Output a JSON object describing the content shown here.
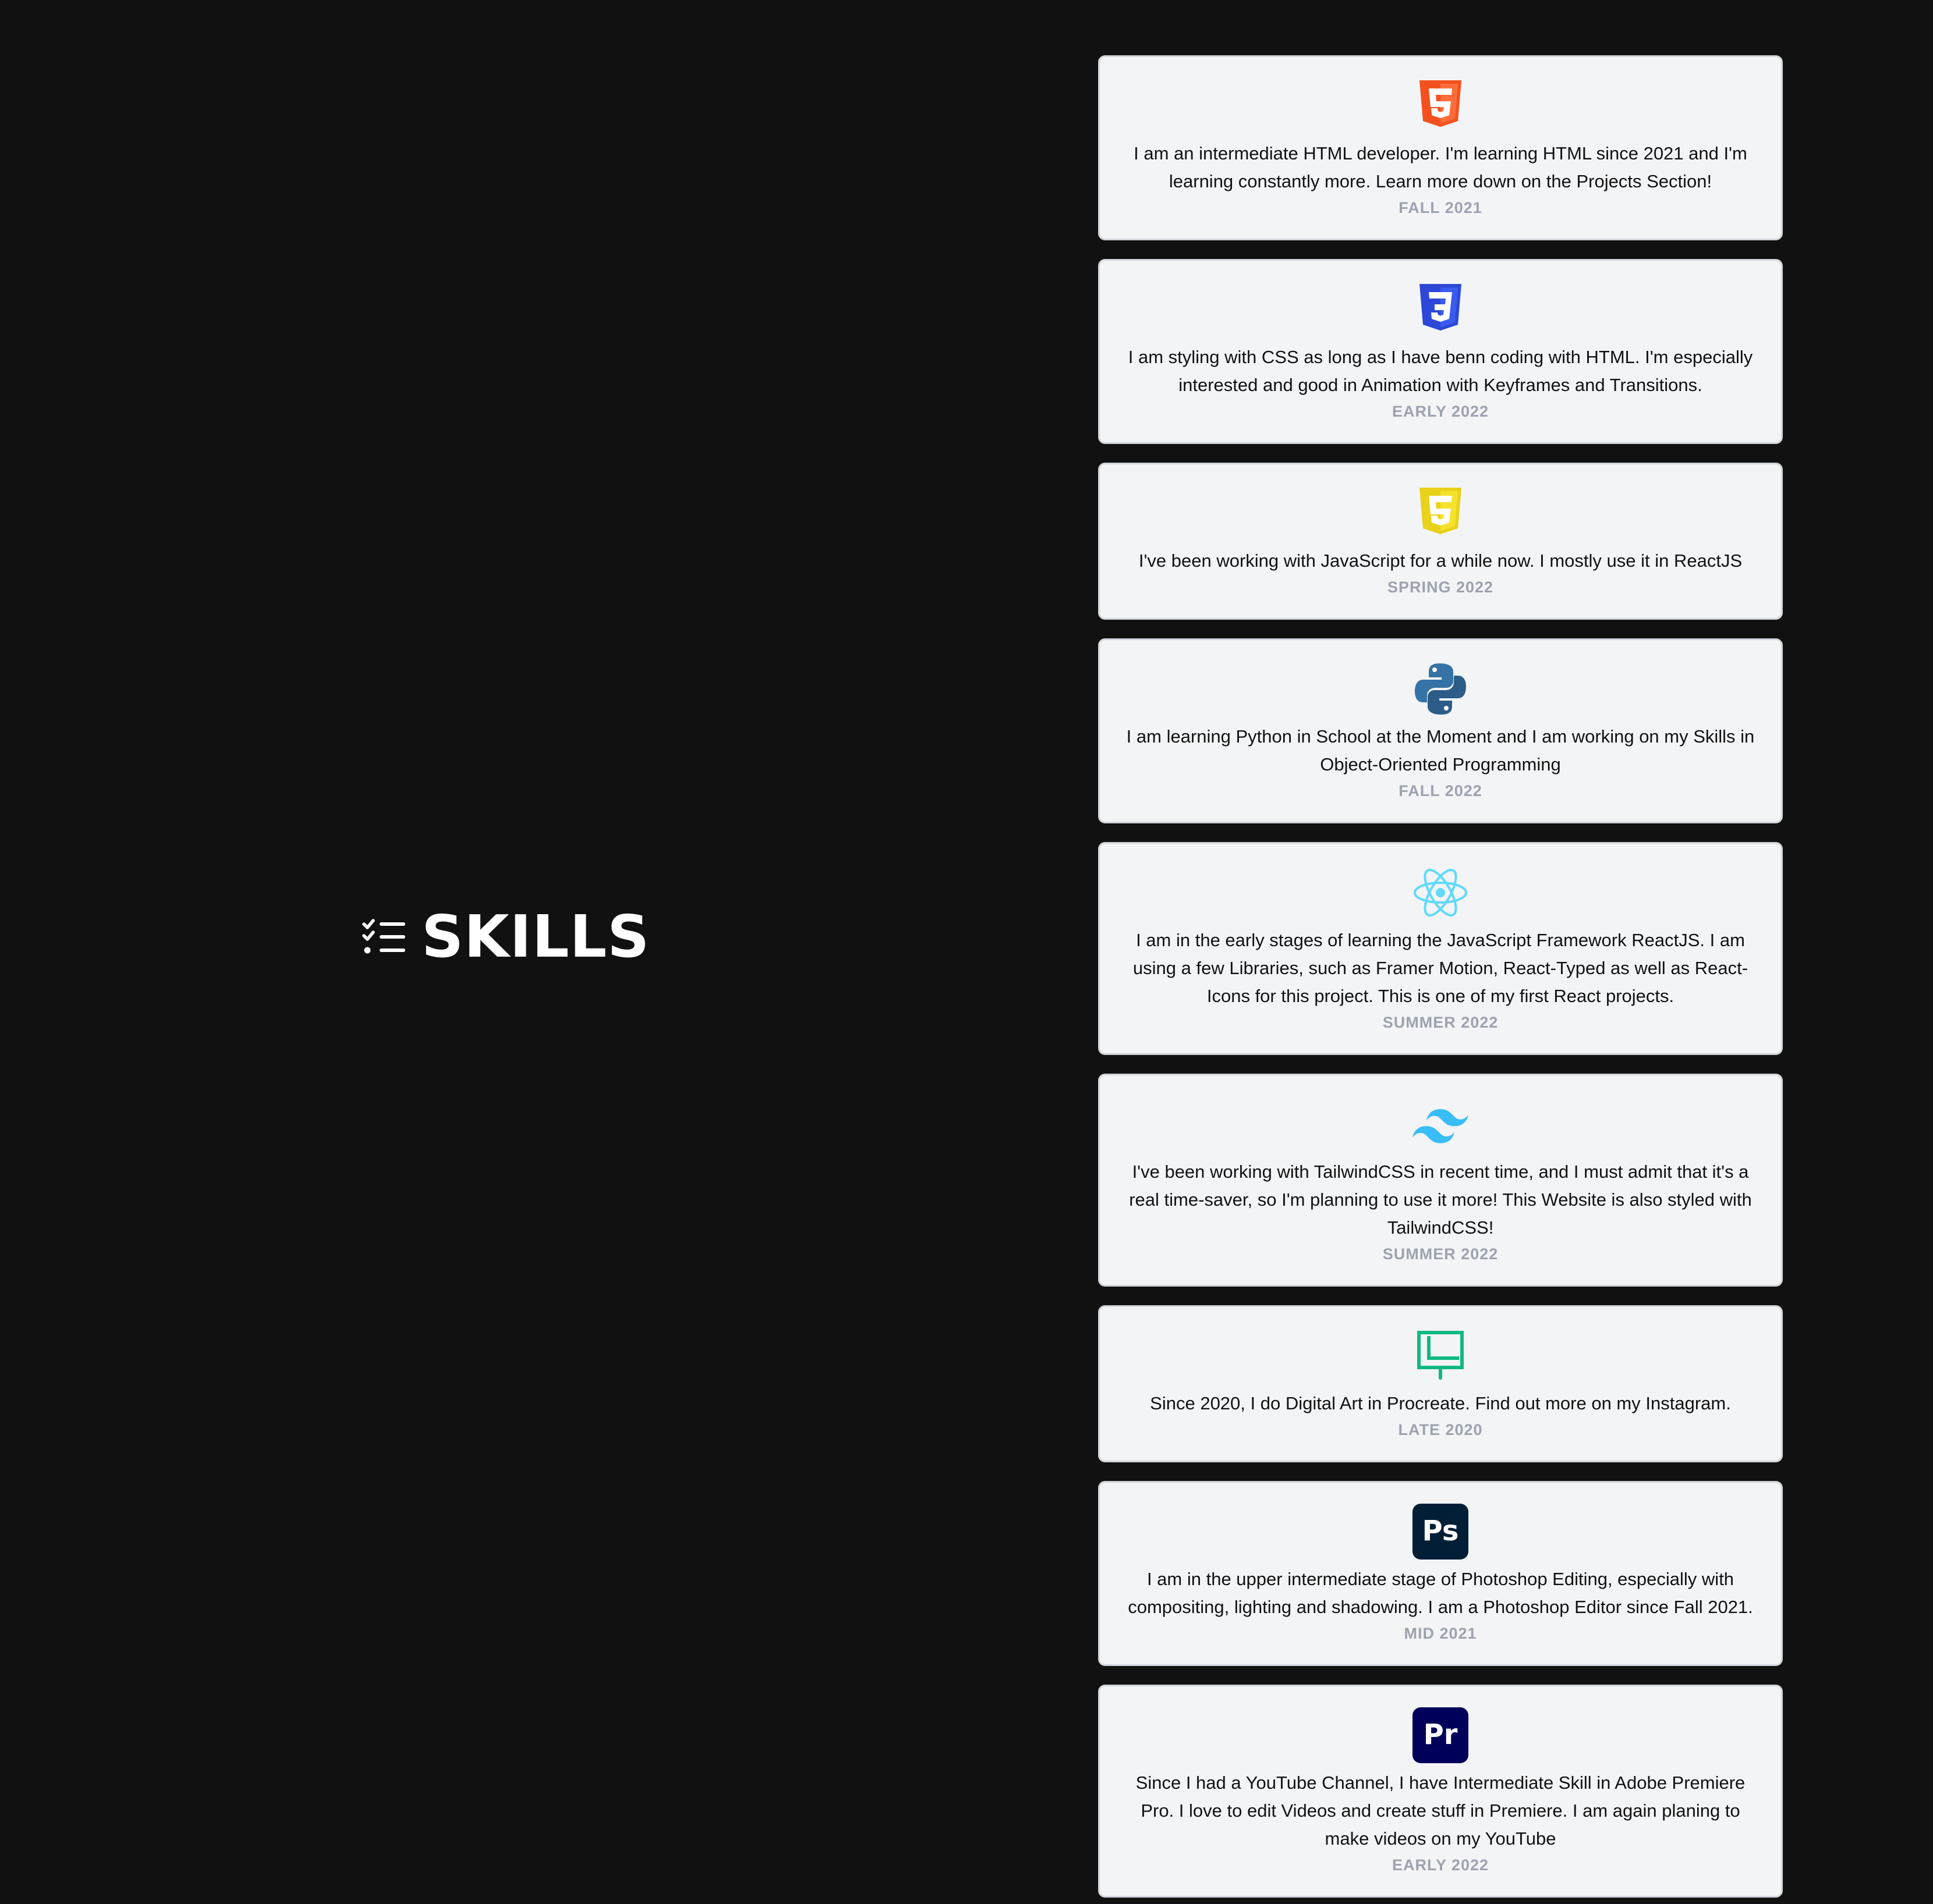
{
  "section": {
    "title": "SKILLS",
    "icon": "checklist-icon"
  },
  "skills": [
    {
      "icon": "html5-icon",
      "description": "I am an intermediate HTML developer. I'm learning HTML since 2021 and I'm learning constantly more. Learn more down on the Projects Section!",
      "date": "FALL 2021"
    },
    {
      "icon": "css3-icon",
      "description": "I am styling with CSS as long as I have benn coding with HTML. I'm especially interested and good in Animation with Keyframes and Transitions.",
      "date": "EARLY 2022"
    },
    {
      "icon": "javascript-icon",
      "description": "I've been working with JavaScript for a while now. I mostly use it in ReactJS",
      "date": "SPRING 2022"
    },
    {
      "icon": "python-icon",
      "description": "I am learning Python in School at the Moment and I am working on my Skills in Object-Oriented Programming",
      "date": "FALL 2022"
    },
    {
      "icon": "react-icon",
      "description": "I am in the early stages of learning the JavaScript Framework ReactJS. I am using a few Libraries, such as Framer Motion, React-Typed as well as React-Icons for this project. This is one of my first React projects.",
      "date": "SUMMER 2022"
    },
    {
      "icon": "tailwindcss-icon",
      "description": "I've been working with TailwindCSS in recent time, and I must admit that it's a real time-saver, so I'm planning to use it more! This Website is also styled with TailwindCSS!",
      "date": "SUMMER 2022"
    },
    {
      "icon": "procreate-icon",
      "description": "Since 2020, I do Digital Art in Procreate. Find out more on my Instagram.",
      "date": "LATE 2020"
    },
    {
      "icon": "photoshop-icon",
      "logo_text": "Ps",
      "description": "I am in the upper intermediate stage of Photoshop Editing, especially with compositing, lighting and shadowing. I am a Photoshop Editor since Fall 2021.",
      "date": "MID 2021"
    },
    {
      "icon": "premiere-pro-icon",
      "logo_text": "Pr",
      "description": "Since I had a YouTube Channel, I have Intermediate Skill in Adobe Premiere Pro. I love to edit Videos and create stuff in Premiere. I am again planing to make videos on my YouTube",
      "date": "EARLY 2022"
    }
  ],
  "colors": {
    "background": "#111111",
    "card_background": "#f3f4f6",
    "card_border": "#d1d5db",
    "date_text": "#9ca3af",
    "html5": "#f4511e",
    "css3": "#2d48d8",
    "javascript": "#f0db1c",
    "python_blue": "#3572a5",
    "react": "#61dafb",
    "tailwind": "#38bdf8",
    "procreate": "#10b981",
    "photoshop_bg": "#001e36",
    "photoshop_text": "#31a8ff",
    "premiere_bg": "#00005b",
    "premiere_text": "#9999ff"
  }
}
